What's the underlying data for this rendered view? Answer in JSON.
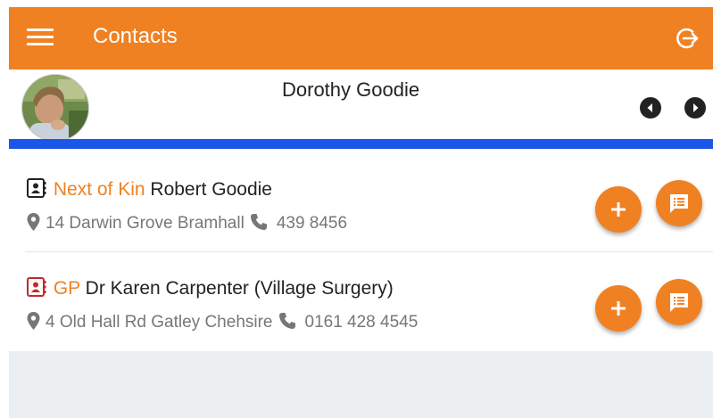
{
  "header": {
    "title": "Contacts",
    "menu_icon": "hamburger-menu-icon",
    "logout_icon": "logout-icon",
    "bar_color": "#ef8123"
  },
  "profile": {
    "name": "Dorothy Goodie",
    "prev_icon": "chevron-left-circle-icon",
    "next_icon": "chevron-right-circle-icon"
  },
  "contacts": [
    {
      "role": "Next of Kin",
      "name": "Robert Goodie",
      "address": "14 Darwin Grove Bramhall",
      "phone": "439 8456",
      "icon": "contact-card-icon",
      "icon_color": "#222222"
    },
    {
      "role": "GP",
      "name": "Dr Karen Carpenter (Village Surgery)",
      "address": "4 Old Hall Rd Gatley Chehsire",
      "phone": "0161 428 4545",
      "icon": "contact-card-icon",
      "icon_color": "#c62828"
    }
  ],
  "colors": {
    "accent": "#ef8123",
    "divider_blue": "#1a56e8",
    "footer_bg": "#eceff1"
  }
}
